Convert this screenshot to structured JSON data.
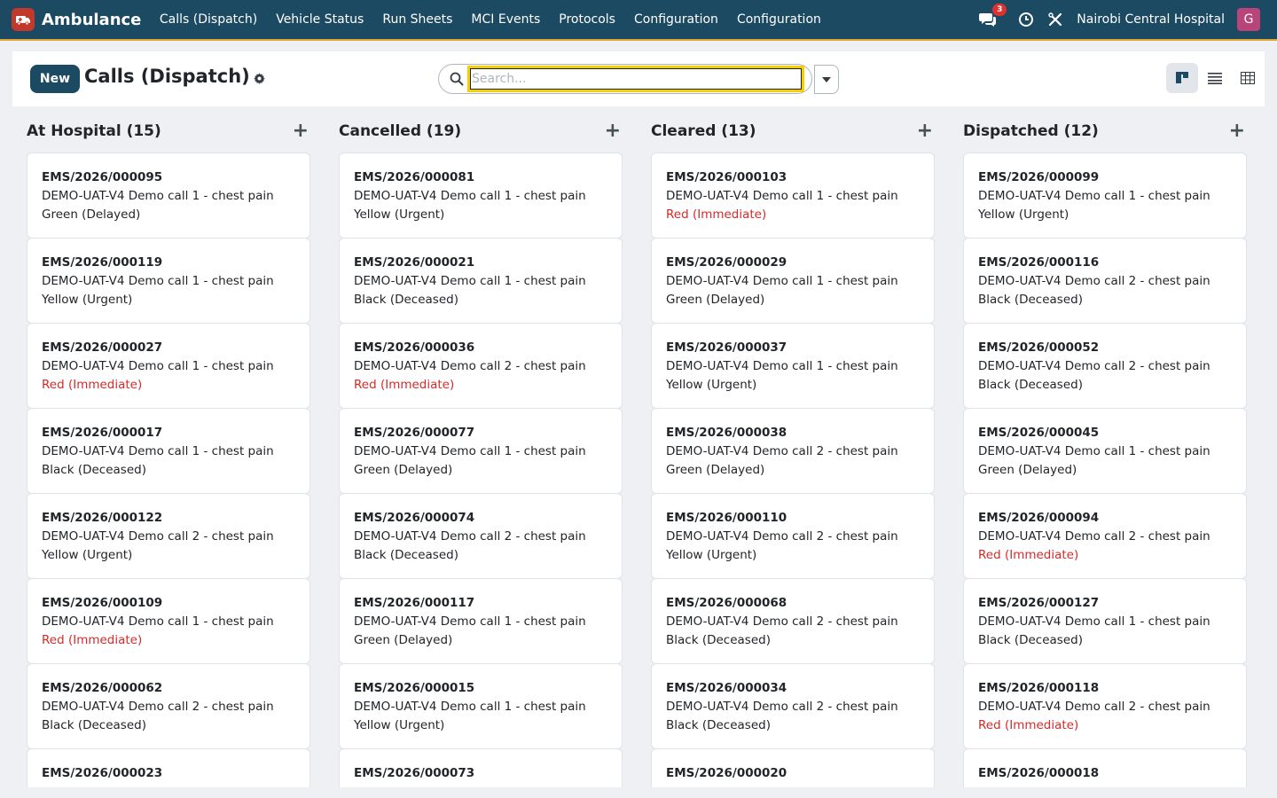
{
  "navbar": {
    "app_name": "Ambulance",
    "menu": [
      "Calls (Dispatch)",
      "Vehicle Status",
      "Run Sheets",
      "MCI Events",
      "Protocols",
      "Configuration",
      "Configuration"
    ],
    "messages_count": "3",
    "company": "Nairobi Central Hospital",
    "avatar_letter": "G"
  },
  "control": {
    "new_label": "New",
    "title": "Calls (Dispatch)",
    "search_placeholder": "Search..."
  },
  "columns": [
    {
      "title": "At Hospital (15)",
      "cards": [
        {
          "ref": "EMS/2026/000095",
          "desc": "DEMO-UAT-V4 Demo call 1 - chest pain",
          "priority": "Green (Delayed)"
        },
        {
          "ref": "EMS/2026/000119",
          "desc": "DEMO-UAT-V4 Demo call 1 - chest pain",
          "priority": "Yellow (Urgent)"
        },
        {
          "ref": "EMS/2026/000027",
          "desc": "DEMO-UAT-V4 Demo call 1 - chest pain",
          "priority": "Red (Immediate)"
        },
        {
          "ref": "EMS/2026/000017",
          "desc": "DEMO-UAT-V4 Demo call 1 - chest pain",
          "priority": "Black (Deceased)"
        },
        {
          "ref": "EMS/2026/000122",
          "desc": "DEMO-UAT-V4 Demo call 2 - chest pain",
          "priority": "Yellow (Urgent)"
        },
        {
          "ref": "EMS/2026/000109",
          "desc": "DEMO-UAT-V4 Demo call 1 - chest pain",
          "priority": "Red (Immediate)"
        },
        {
          "ref": "EMS/2026/000062",
          "desc": "DEMO-UAT-V4 Demo call 2 - chest pain",
          "priority": "Black (Deceased)"
        },
        {
          "ref": "EMS/2026/000023",
          "desc": "",
          "priority": ""
        }
      ]
    },
    {
      "title": "Cancelled (19)",
      "cards": [
        {
          "ref": "EMS/2026/000081",
          "desc": "DEMO-UAT-V4 Demo call 1 - chest pain",
          "priority": "Yellow (Urgent)"
        },
        {
          "ref": "EMS/2026/000021",
          "desc": "DEMO-UAT-V4 Demo call 1 - chest pain",
          "priority": "Black (Deceased)"
        },
        {
          "ref": "EMS/2026/000036",
          "desc": "DEMO-UAT-V4 Demo call 2 - chest pain",
          "priority": "Red (Immediate)"
        },
        {
          "ref": "EMS/2026/000077",
          "desc": "DEMO-UAT-V4 Demo call 1 - chest pain",
          "priority": "Green (Delayed)"
        },
        {
          "ref": "EMS/2026/000074",
          "desc": "DEMO-UAT-V4 Demo call 2 - chest pain",
          "priority": "Black (Deceased)"
        },
        {
          "ref": "EMS/2026/000117",
          "desc": "DEMO-UAT-V4 Demo call 1 - chest pain",
          "priority": "Green (Delayed)"
        },
        {
          "ref": "EMS/2026/000015",
          "desc": "DEMO-UAT-V4 Demo call 1 - chest pain",
          "priority": "Yellow (Urgent)"
        },
        {
          "ref": "EMS/2026/000073",
          "desc": "",
          "priority": ""
        }
      ]
    },
    {
      "title": "Cleared (13)",
      "cards": [
        {
          "ref": "EMS/2026/000103",
          "desc": "DEMO-UAT-V4 Demo call 1 - chest pain",
          "priority": "Red (Immediate)"
        },
        {
          "ref": "EMS/2026/000029",
          "desc": "DEMO-UAT-V4 Demo call 1 - chest pain",
          "priority": "Green (Delayed)"
        },
        {
          "ref": "EMS/2026/000037",
          "desc": "DEMO-UAT-V4 Demo call 1 - chest pain",
          "priority": "Yellow (Urgent)"
        },
        {
          "ref": "EMS/2026/000038",
          "desc": "DEMO-UAT-V4 Demo call 2 - chest pain",
          "priority": "Green (Delayed)"
        },
        {
          "ref": "EMS/2026/000110",
          "desc": "DEMO-UAT-V4 Demo call 2 - chest pain",
          "priority": "Yellow (Urgent)"
        },
        {
          "ref": "EMS/2026/000068",
          "desc": "DEMO-UAT-V4 Demo call 2 - chest pain",
          "priority": "Black (Deceased)"
        },
        {
          "ref": "EMS/2026/000034",
          "desc": "DEMO-UAT-V4 Demo call 2 - chest pain",
          "priority": "Black (Deceased)"
        },
        {
          "ref": "EMS/2026/000020",
          "desc": "",
          "priority": ""
        }
      ]
    },
    {
      "title": "Dispatched (12)",
      "cards": [
        {
          "ref": "EMS/2026/000099",
          "desc": "DEMO-UAT-V4 Demo call 1 - chest pain",
          "priority": "Yellow (Urgent)"
        },
        {
          "ref": "EMS/2026/000116",
          "desc": "DEMO-UAT-V4 Demo call 2 - chest pain",
          "priority": "Black (Deceased)"
        },
        {
          "ref": "EMS/2026/000052",
          "desc": "DEMO-UAT-V4 Demo call 2 - chest pain",
          "priority": "Black (Deceased)"
        },
        {
          "ref": "EMS/2026/000045",
          "desc": "DEMO-UAT-V4 Demo call 1 - chest pain",
          "priority": "Green (Delayed)"
        },
        {
          "ref": "EMS/2026/000094",
          "desc": "DEMO-UAT-V4 Demo call 2 - chest pain",
          "priority": "Red (Immediate)"
        },
        {
          "ref": "EMS/2026/000127",
          "desc": "DEMO-UAT-V4 Demo call 1 - chest pain",
          "priority": "Black (Deceased)"
        },
        {
          "ref": "EMS/2026/000118",
          "desc": "DEMO-UAT-V4 Demo call 2 - chest pain",
          "priority": "Red (Immediate)"
        },
        {
          "ref": "EMS/2026/000018",
          "desc": "",
          "priority": ""
        }
      ]
    }
  ],
  "colors": {
    "navbar_bg": "#1c4a63",
    "accent_bar": "#e0a63a",
    "primary_button": "#1c4a63",
    "priority_red": "#d42a2a",
    "avatar_bg": "#b8457a",
    "search_focus": "#f5cf00"
  },
  "icons": {
    "app": "ambulance-icon",
    "messages": "chat-bubbles-icon",
    "activity": "clock-icon",
    "tools": "tools-icon",
    "settings": "gear-icon",
    "search": "search-icon",
    "dropdown": "caret-down-icon",
    "views": [
      "kanban-view-icon",
      "list-view-icon",
      "pivot-view-icon"
    ]
  }
}
